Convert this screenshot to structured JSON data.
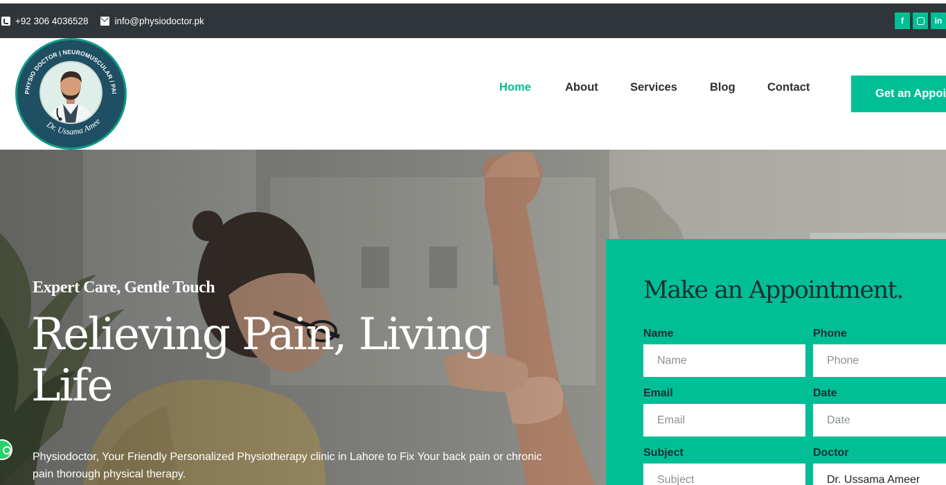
{
  "topbar": {
    "phone": "+92 306 4036528",
    "email": "info@physiodoctor.pk",
    "socials": [
      {
        "icon": "facebook-icon",
        "glyph": "f"
      },
      {
        "icon": "instagram-icon",
        "glyph": ""
      },
      {
        "icon": "linkedin-icon",
        "glyph": "in"
      }
    ],
    "accent": "#00bf96",
    "background": "#2f3538"
  },
  "logo": {
    "ring_text": "PHYSIO DOCTOR | NEUROMUSCULAR / PAIN SPECIALIST",
    "name_text": "Dr. Ussama Ameer"
  },
  "nav": {
    "items": [
      "Home",
      "About",
      "Services",
      "Blog",
      "Contact"
    ],
    "active": "Home",
    "cta": "Get an Appointment"
  },
  "hero": {
    "tagline": "Expert Care, Gentle Touch",
    "title": "Relieving Pain, Living Life",
    "description": "Physiodoctor, Your Friendly Personalized Physiotherapy clinic in Lahore to Fix Your back pain or chronic pain thorough physical therapy."
  },
  "appointment": {
    "title": "Make an Appointment.",
    "fields": {
      "name": {
        "label": "Name",
        "placeholder": "Name"
      },
      "phone": {
        "label": "Phone",
        "placeholder": "Phone"
      },
      "email": {
        "label": "Email",
        "placeholder": "Email"
      },
      "date": {
        "label": "Date",
        "placeholder": "Date"
      },
      "subject": {
        "label": "Subject",
        "placeholder": "Subject"
      },
      "doctor": {
        "label": "Doctor",
        "value": "Dr. Ussama Ameer"
      }
    },
    "panel_color": "#00bf96"
  }
}
